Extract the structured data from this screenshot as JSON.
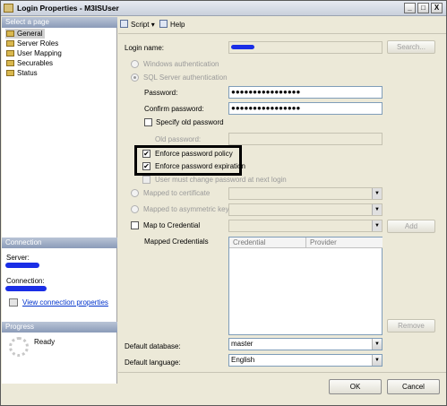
{
  "window": {
    "title": "Login Properties - M3ISUser",
    "minimize": "_",
    "maximize": "□",
    "close": "X"
  },
  "left_pane": {
    "select_page_header": "Select a page",
    "pages": [
      "General",
      "Server Roles",
      "User Mapping",
      "Securables",
      "Status"
    ],
    "selected_page": "General",
    "connection_header": "Connection",
    "server_label": "Server:",
    "connection_label": "Connection:",
    "view_connection_properties": "View connection properties",
    "progress_header": "Progress",
    "progress_status": "Ready"
  },
  "toolbar": {
    "script": "Script",
    "script_arrow": "▾",
    "help": "Help"
  },
  "general": {
    "login_name_label": "Login name:",
    "search_button": "Search...",
    "windows_auth": "Windows authentication",
    "sql_auth": "SQL Server authentication",
    "password_label": "Password:",
    "password_value": "●●●●●●●●●●●●●●●●",
    "confirm_password_label": "Confirm password:",
    "confirm_password_value": "●●●●●●●●●●●●●●●●",
    "specify_old_password": "Specify old password",
    "old_password_label": "Old password:",
    "enforce_policy": "Enforce password policy",
    "enforce_expiration": "Enforce password expiration",
    "must_change": "User must change password at next login",
    "check_mark": "✔",
    "mapped_to_certificate": "Mapped to certificate",
    "mapped_to_asymmetric_key": "Mapped to asymmetric key",
    "map_to_credential": "Map to Credential",
    "add_button": "Add",
    "mapped_credentials_label": "Mapped Credentials",
    "credential_columns": [
      "Credential",
      "Provider"
    ],
    "remove_button": "Remove",
    "default_database_label": "Default database:",
    "default_database_value": "master",
    "default_language_label": "Default language:",
    "default_language_value": "English",
    "combo_arrow": "▼"
  },
  "footer": {
    "ok": "OK",
    "cancel": "Cancel"
  }
}
